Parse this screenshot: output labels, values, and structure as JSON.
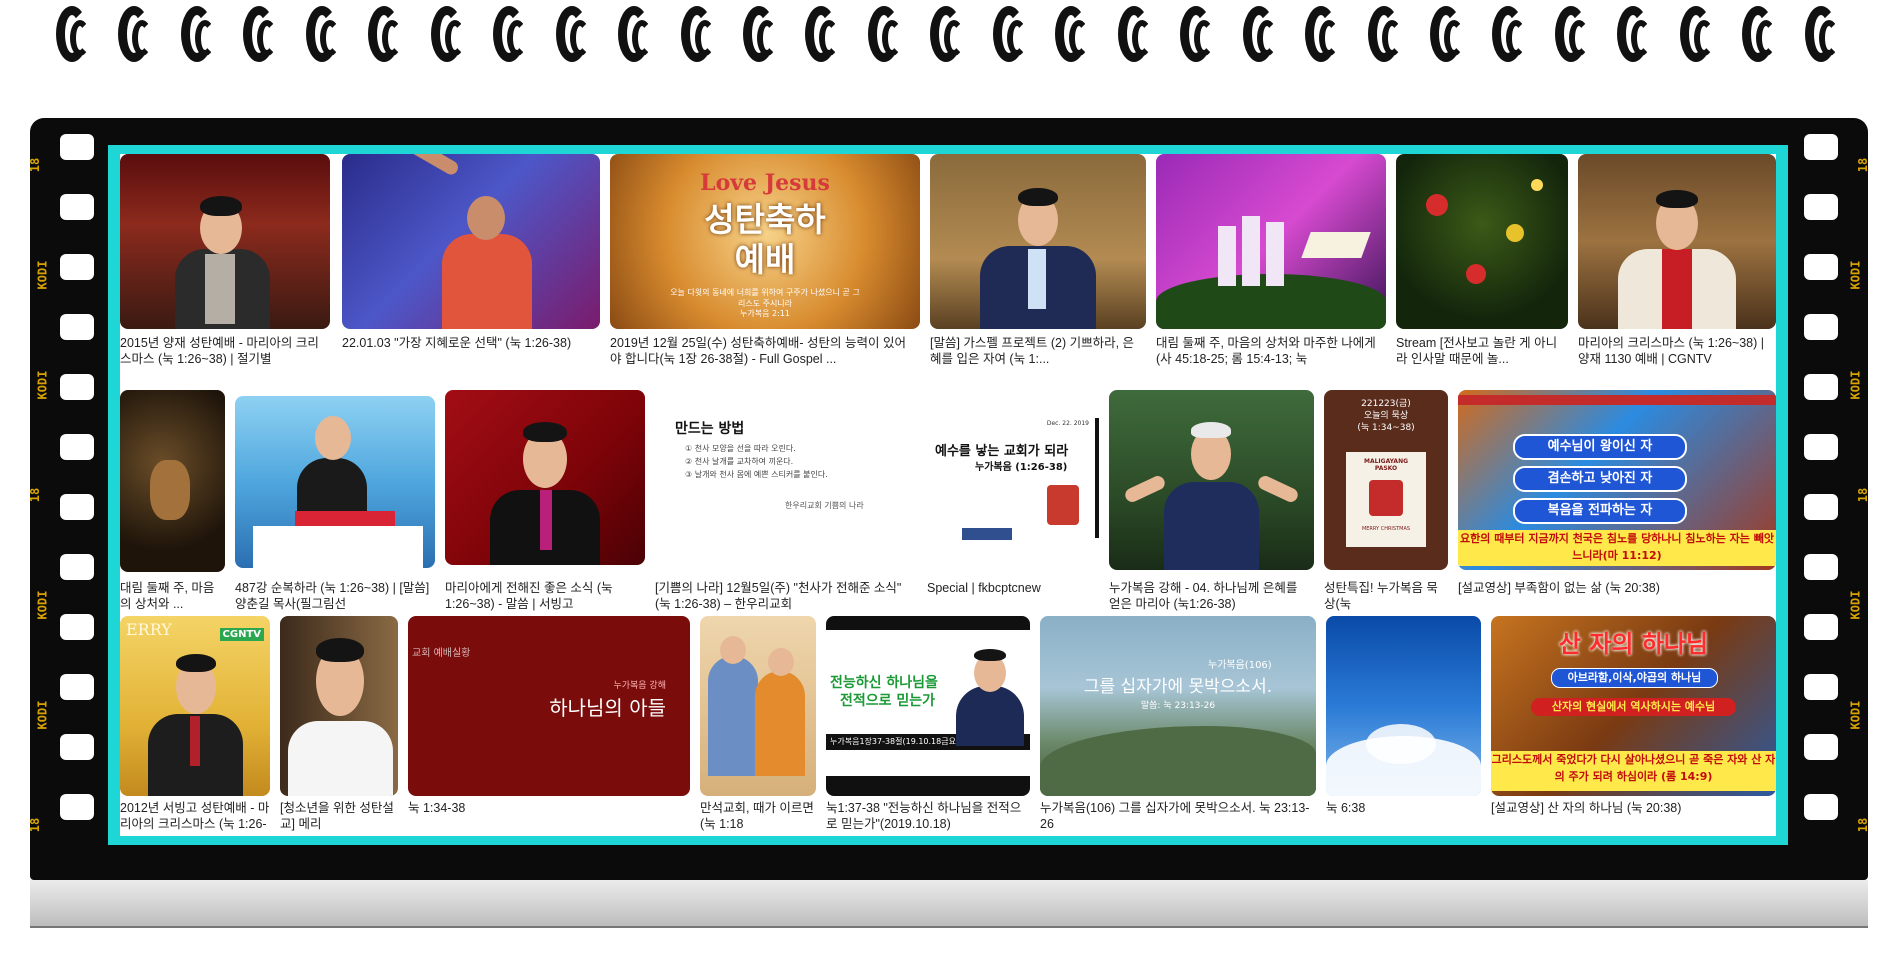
{
  "film": {
    "edge_code": "KODI",
    "edge_num": "18"
  },
  "row1": [
    {
      "caption": "2015년 양재 성탄예배 - 마리아의 크리스마스 (눅 1:26~38) | 절기별"
    },
    {
      "caption": "22.01.03 \"가장 지혜로운 선택\" (눅 1:26-38)"
    },
    {
      "caption": "2019년 12월 25일(수) 성탄축하예배- 성탄의 능력이 있어야 합니다(눅 1장 26-38절) - Full Gospel ...",
      "title_en": "Love Jesus",
      "title_ko": "성탄축하\n예배",
      "verse": "오늘 다윗의 동네에 너희를 위하여 구주가 나셨으니 곧 그리스도 주시니라",
      "verse_ref": "누가복음 2:11"
    },
    {
      "caption": "[말씀] 가스펠 프로젝트 (2) 기쁘하라, 은혜를 입은 자여 (눅 1:..."
    },
    {
      "caption": "대림 둘째 주, 마음의 상처와 마주한 나에게(사 45:18-25; 롬 15:4-13; 눅"
    },
    {
      "caption": "Stream [전사보고 놀란 게 아니라 인사말 때문에 놀..."
    },
    {
      "caption": "마리아의 크리스마스 (눅 1:26~38) | 양재 1130 예배 | CGNTV"
    }
  ],
  "row2": [
    {
      "caption": "대림 둘째 주, 마음의 상처와 ..."
    },
    {
      "caption": "487강 순복하라 (눅 1:26~38) | [말씀] 양춘길 목사(필그림선"
    },
    {
      "caption": "마리아에게 전해진 좋은 소식 (눅 1:26~38) - 말씀 | 서빙고"
    },
    {
      "caption": "[기쁨의 나라] 12월5일(주) \"천사가 전해준 소식\" (눅 1:26-38) – 한우리교회",
      "heading": "만드는 방법",
      "steps": [
        "① 천사 모양을 선을 따라 오린다.",
        "② 천사 날개를 교차하여 끼운다.",
        "③ 날개와 천사 몸에 예쁜 스티커를 붙인다."
      ],
      "footer": "한우리교회 기쁨의 나라"
    },
    {
      "caption": "Special | fkbcptcnew",
      "title": "예수를 낳는 교회가 되라",
      "sub": "누가복음 (1:26-38)",
      "date": "Dec. 22. 2019"
    },
    {
      "caption": "누가복음 강해 - 04. 하나님께 은혜를 얻은 마리아 (눅1:26-38)"
    },
    {
      "caption": "성탄특집! 누가복음 묵상(눅",
      "top": "221223(금)\n오늘의 묵상\n(눅 1:34~38)",
      "card": "MALIGAYANG\nPASKO",
      "card_sub": "MERRY CHRISTMAS"
    },
    {
      "caption": "[설교영상] 부족함이 없는 삶 (눅 20:38)",
      "lines": [
        "예수님이 왕이신 자",
        "겸손하고 낮아진 자",
        "복음을 전파하는 자"
      ],
      "bottom": "요한의 때부터 지금까지 천국은 침노를 당하나니 침노하는 자는 빼앗느니라(마 11:12)"
    }
  ],
  "row3": [
    {
      "caption": "2012년 서빙고 성탄예배 - 마리아의 크리스마스 (눅 1:26-",
      "brand": "CGNTV",
      "deco": "ERRY"
    },
    {
      "caption": "[청소년을 위한 성탄설교] 메리"
    },
    {
      "caption": "눅 1:34-38",
      "small": "누가복음 강해",
      "title": "하나님의 아들",
      "corner": "교회 예배실황"
    },
    {
      "caption": "만석교회, 때가 이르면(눅 1:18"
    },
    {
      "caption": "눅1:37-38 \"전능하신 하나님을 전적으로 믿는가\"(2019.10.18)",
      "t1": "전능하신 하나님을",
      "t2": "전적으로 믿는가",
      "t3": "누가복음1장37-38절(19.10.18금요예배)"
    },
    {
      "caption": "누가복음(106) 그를 십자가에 못박으소서. 눅 23:13-26",
      "label": "누가복음(106)",
      "title": "그를 십자가에 못박으소서.",
      "ref": "말씀: 눅 23:13-26"
    },
    {
      "caption": "눅 6:38"
    },
    {
      "caption": "[설교영상] 산 자의 하나님 (눅 20:38)",
      "title": "산 자의 하나님",
      "l1": "아브라함,이삭,야곱의 하나님",
      "l2": "산자의 현실에서 역사하시는 예수님",
      "bottom": "그리스도께서 죽었다가 다시 살아나셨으니 곧 죽은 자와 산 자의 주가 되려 하심이라 (롬 14:9)"
    }
  ],
  "colors": {
    "frame": "#1fd6d6",
    "film": "#0b0b0b",
    "edge": "#d9a300"
  }
}
